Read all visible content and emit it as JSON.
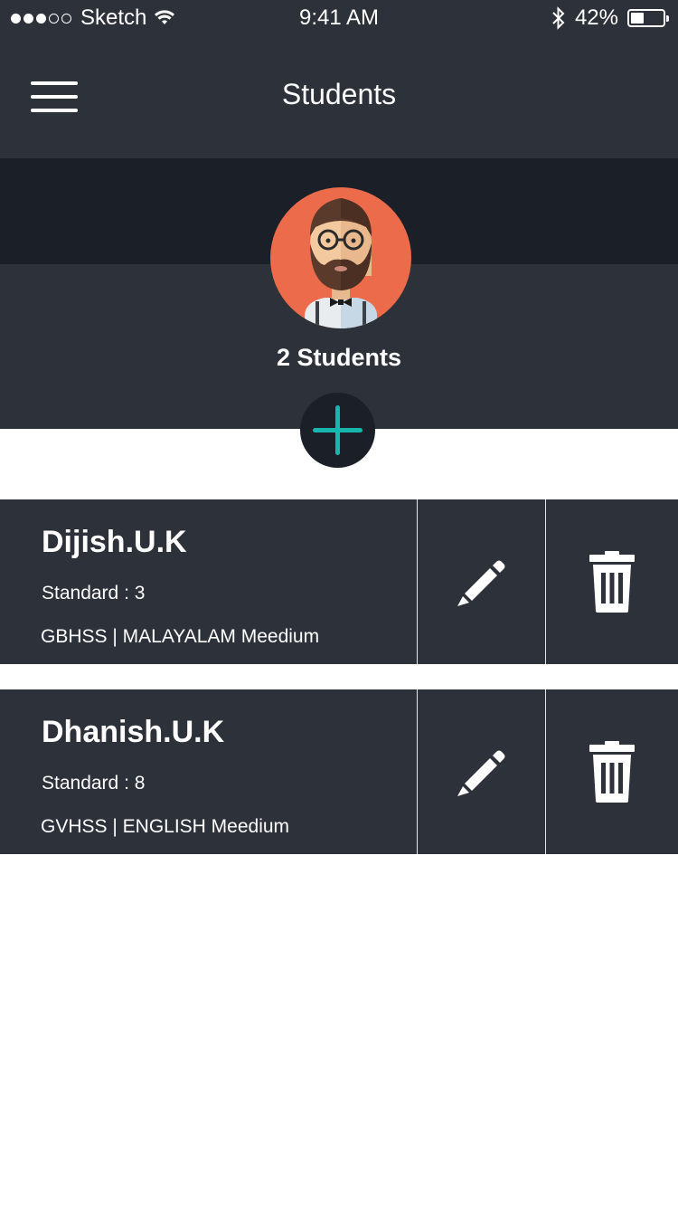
{
  "status": {
    "carrier": "Sketch",
    "time": "9:41 AM",
    "battery": "42%",
    "battery_level": 0.42,
    "signal_filled": 3,
    "signal_total": 5
  },
  "header": {
    "title": "Students",
    "menu_icon": "hamburger-menu-icon"
  },
  "summary": {
    "count_label": "2 Students",
    "add_icon": "plus-icon"
  },
  "colors": {
    "header_bg": "#2d3139",
    "dark_band": "#1b1f28",
    "avatar_bg": "#ec6b4a",
    "accent": "#19b6b0",
    "card_bg": "#2d3139"
  },
  "students": [
    {
      "name": "Dijish.U.K",
      "standard": "Standard : 3",
      "school": "GBHSS | MALAYALAM Meedium",
      "edit_icon": "pencil-icon",
      "delete_icon": "trash-icon"
    },
    {
      "name": "Dhanish.U.K",
      "standard": "Standard : 8",
      "school": "GVHSS | ENGLISH Meedium",
      "edit_icon": "pencil-icon",
      "delete_icon": "trash-icon"
    }
  ]
}
